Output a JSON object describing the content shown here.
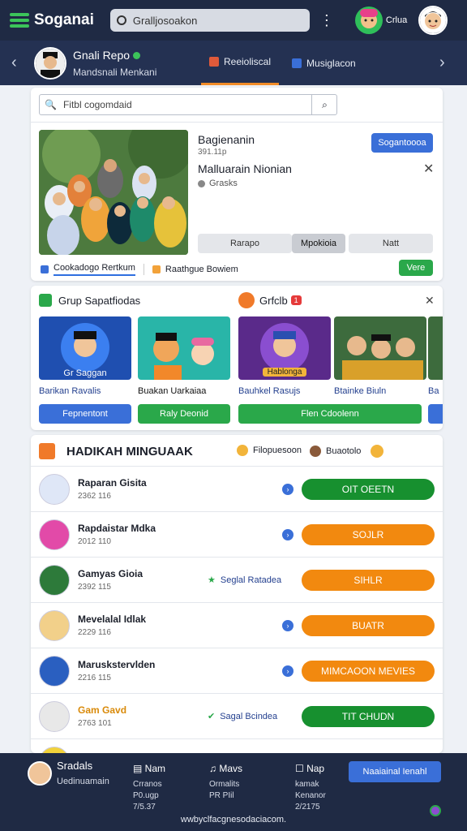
{
  "topbar": {
    "app_title": "Soganai",
    "search_placeholder": "Gralljosoakon",
    "user_name": "Crlua"
  },
  "profile": {
    "name": "Gnali Repo",
    "department": "Mandsnali Menkani",
    "tabs": [
      "Reeioliscal",
      "Musiglacon"
    ]
  },
  "main_card": {
    "search_placeholder": "Fitbl cogomdaid",
    "item_title": "Bagienanin",
    "item_meta": "391.11p",
    "item_name": "Malluarain Nionian",
    "item_sub": "Grasks",
    "primary_button": "Sogantoooa",
    "filters": [
      "Rarapo",
      "Mpokioia",
      "Natt"
    ],
    "tabs": [
      "Cookadogo Rertkum",
      "Raathgue Bowiem"
    ],
    "vere_button": "Vere"
  },
  "carousel": {
    "title": "Grup Sapatfiodas",
    "secondary_title": "Grfclb",
    "badge": "1",
    "items": [
      {
        "overlay": "Gr Saggan",
        "title": "Barikan Ravalis",
        "button": "Fepnentont",
        "color": "#3a6fd8"
      },
      {
        "overlay": "",
        "title": "Buakan Uarkaiaa",
        "button": "Raly Deonid",
        "color": "#2aa84a"
      },
      {
        "overlay": "Hablonga",
        "title": "Bauhkel Rasujs",
        "button": "Flen Cdoolenn",
        "color": "#2aa84a"
      },
      {
        "overlay": "",
        "title": "Btainke Biuln",
        "button": "",
        "color": "#2aa84a"
      },
      {
        "overlay": "",
        "title": "Ba",
        "button": "",
        "color": "#3a6fd8"
      }
    ]
  },
  "list": {
    "title": "HADIKAH MINGUAAK",
    "header_links": [
      "Filopuesoon",
      "Buaotolo"
    ],
    "rows": [
      {
        "name": "Raparan Gisita",
        "sub": "2362 116",
        "tag": "",
        "action": "OIT OEETN",
        "color": "#17902f"
      },
      {
        "name": "Rapdaistar Mdka",
        "sub": "2012 110",
        "tag": "",
        "action": "SOJLR",
        "color": "#f2890f"
      },
      {
        "name": "Gamyas Gioia",
        "sub": "2392 115",
        "tag": "Seglal Ratadea",
        "action": "SIHLR",
        "color": "#f2890f"
      },
      {
        "name": "Mevelalal Idlak",
        "sub": "2229 116",
        "tag": "",
        "action": "BUATR",
        "color": "#f2890f"
      },
      {
        "name": "Maruskstervlden",
        "sub": "2216 115",
        "tag": "",
        "action": "MIMCAOON MEVIES",
        "color": "#f2890f"
      },
      {
        "name": "Gam Gavd",
        "sub": "2763 101",
        "tag": "Sagal Bcindea",
        "action": "TIT CHUDN",
        "color": "#17902f"
      }
    ]
  },
  "bottombar": {
    "user_name": "Sradals",
    "user_sub": "Uedinuamain",
    "cols": [
      {
        "h": "Nam",
        "l1": "Crranos",
        "l2": "P0.ugp",
        "l3": "7/5.37"
      },
      {
        "h": "Mavs",
        "l1": "Ormalits",
        "l2": "PR PIil",
        "l3": ""
      },
      {
        "h": "Nap",
        "l1": "kamak",
        "l2": "Kenanor",
        "l3": "2/2175"
      }
    ],
    "cta": "Naaiainal Ienahl",
    "url": "wwbyclfacgnesodaciacom."
  }
}
